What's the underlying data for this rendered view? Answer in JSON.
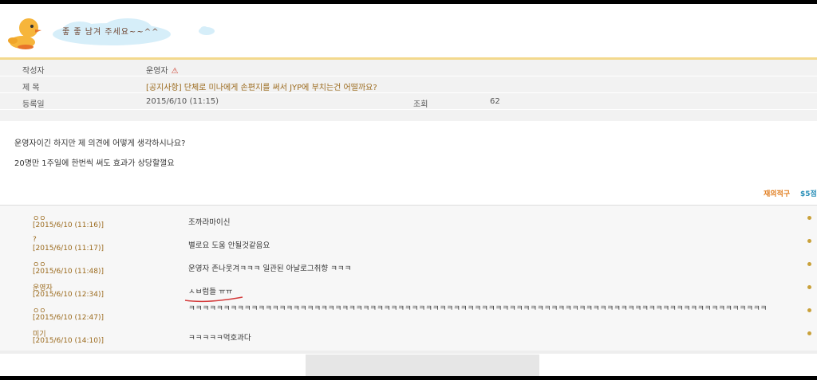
{
  "banner": {
    "text": "좋 좋 남겨 주세요~~^^"
  },
  "post": {
    "author_label": "작성자",
    "author_value": "운영자",
    "title_label": "제 목",
    "title_value": "[공지사항] 단체로 미나에게 손편지를 써서 JYP에 부치는건 어떨까요?",
    "date_label": "등록일",
    "date_value": "2015/6/10 (11:15)",
    "views_label": "조회",
    "views_value": "62",
    "body": [
      "운영자이긴 하지만 제 의견에 어떻게 생각하시나요?",
      "20명만 1주일에 한번씩 써도 효과가 상당할껄요"
    ],
    "report_label": "재의적구",
    "stars_label": "$5점"
  },
  "comments": [
    {
      "name": "ㅇㅇ",
      "date": "[2015/6/10 (11:16)]",
      "text": "조까라마이신"
    },
    {
      "name": "?",
      "date": "[2015/6/10 (11:17)]",
      "text": "별로요 도움 안될것같음요"
    },
    {
      "name": "ㅇㅇ",
      "date": "[2015/6/10 (11:48)]",
      "text": "운영자 존나웃겨ㅋㅋㅋ 일관된 아날로그취향 ㅋㅋㅋ"
    },
    {
      "name": "운영자",
      "date": "[2015/6/10 (12:34)]",
      "text": "ㅅㅂ럼들 ㅠㅠ"
    },
    {
      "name": "ㅇㅇ",
      "date": "[2015/6/10 (12:47)]",
      "text": "ㅋㅋㅋㅋㅋㅋㅋㅋㅋㅋㅋㅋㅋㅋㅋㅋㅋㅋㅋㅋㅋㅋㅋㅋㅋㅋㅋㅋㅋㅋㅋㅋㅋㅋㅋㅋㅋㅋㅋㅋㅋㅋㅋㅋㅋㅋㅋㅋㅋㅋㅋㅋㅋㅋㅋㅋㅋㅋㅋㅋㅋㅋㅋㅋㅋㅋㅋㅋㅋㅋㅋㅋㅋㅋㅋㅋㅋㅋㅋㅋㅋㅋㅋ"
    },
    {
      "name": "미기",
      "date": "[2015/6/10 (14:10)]",
      "text": "ㅋㅋㅋㅋㅋ먹호과다"
    }
  ]
}
